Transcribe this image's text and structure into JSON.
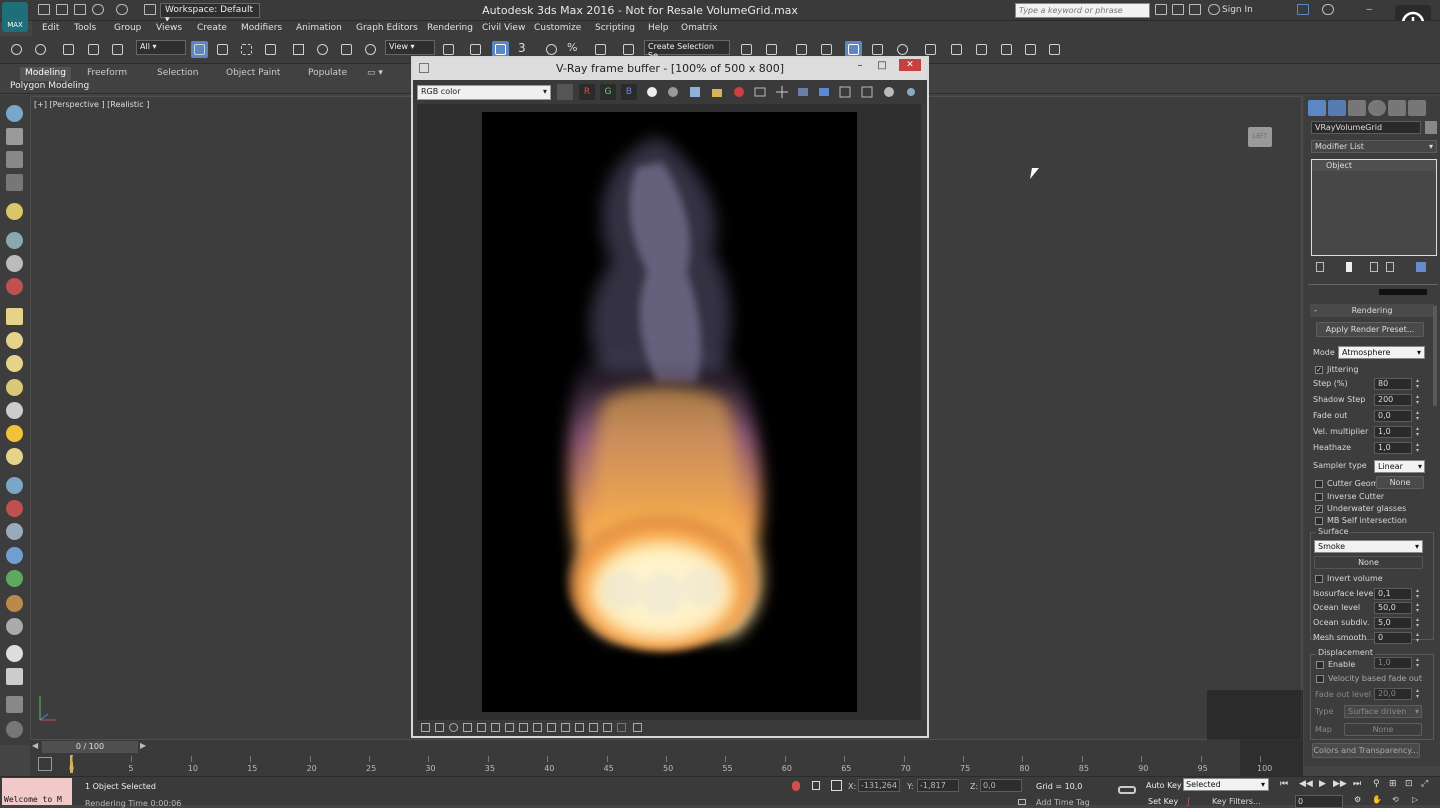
{
  "titlebar": {
    "app_icon_label": "MAX",
    "workspace": "Workspace: Default",
    "title": "Autodesk 3ds Max 2016 - Not for Resale    VolumeGrid.max",
    "search_placeholder": "Type a keyword or phrase",
    "sign_in": "Sign In"
  },
  "menu": [
    "Edit",
    "Tools",
    "Group",
    "Views",
    "Create",
    "Modifiers",
    "Animation",
    "Graph Editors",
    "Rendering",
    "Civil View",
    "Customize",
    "Scripting",
    "Help",
    "Omatrix"
  ],
  "toolbar": {
    "selection_filter": "All",
    "ref_coord": "View",
    "named_selection": "Create Selection Se",
    "snap_3": "3",
    "snap_pct": "%"
  },
  "ribbon": {
    "tabs": [
      "Modeling",
      "Freeform",
      "Selection",
      "Object Paint",
      "Populate"
    ],
    "active_tab": "Modeling",
    "subtab": "Polygon Modeling"
  },
  "viewport": {
    "label": "[+] [Perspective ] [Realistic ]",
    "viewcube": "LEFT"
  },
  "vfb": {
    "title": "V-Ray frame buffer - [100% of 500 x 800]",
    "channel": "RGB color",
    "channel_buttons": [
      "R",
      "G",
      "B"
    ]
  },
  "command_panel": {
    "object_name": "VRayVolumeGrid",
    "modifier_list": "Modifier List",
    "stack_item": "Object",
    "rollout_rendering": "Rendering",
    "apply_preset": "Apply Render Preset...",
    "mode_label": "Mode",
    "mode_value": "Atmosphere",
    "jittering_label": "Jittering",
    "jittering": true,
    "params": [
      {
        "label": "Step (%)",
        "value": "80"
      },
      {
        "label": "Shadow Step",
        "value": "200"
      },
      {
        "label": "Fade out",
        "value": "0,0"
      },
      {
        "label": "Vel. multiplier",
        "value": "1,0"
      },
      {
        "label": "Heathaze",
        "value": "1,0"
      }
    ],
    "sampler_label": "Sampler type",
    "sampler_value": "Linear",
    "cutter_geom_label": "Cutter Geom",
    "cutter_geom_value": "None",
    "inverse_cutter": "Inverse Cutter",
    "underwater": "Underwater glasses",
    "mb_self": "MB Self intersection",
    "surface_group": "Surface",
    "surface_value": "Smoke",
    "surface_none": "None",
    "invert_volume": "Invert volume",
    "surface_params": [
      {
        "label": "Isosurface level",
        "value": "0,1"
      },
      {
        "label": "Ocean level",
        "value": "50,0"
      },
      {
        "label": "Ocean subdiv.",
        "value": "5,0"
      },
      {
        "label": "Mesh smooth",
        "value": "0"
      }
    ],
    "displacement_group": "Displacement",
    "enable_label": "Enable",
    "enable_value": "1,0",
    "velocity_fade": "Velocity based fade out",
    "fade_out_level_label": "Fade out level",
    "fade_out_level_value": "20,0",
    "type_label": "Type",
    "type_value": "Surface driven",
    "map_label": "Map",
    "map_value": "None",
    "colors_btn": "Colors and Transparency..."
  },
  "timeline": {
    "slider": "0 / 100",
    "ticks": [
      "0",
      "5",
      "10",
      "15",
      "20",
      "25",
      "30",
      "35",
      "40",
      "45",
      "50",
      "55",
      "60",
      "65",
      "70",
      "75",
      "80",
      "85",
      "90",
      "95",
      "100"
    ]
  },
  "status": {
    "maxscript": "Welcome to M",
    "selection": "1 Object Selected",
    "render_time": "Rendering Time  0:00:06",
    "x_label": "X:",
    "x_value": "-131,264",
    "y_label": "Y:",
    "y_value": "-1,817",
    "z_label": "Z:",
    "z_value": "0,0",
    "grid": "Grid = 10,0",
    "add_time_tag": "Add Time Tag",
    "auto_key": "Auto Key",
    "set_key": "Set Key",
    "key_mode": "Selected",
    "key_filters": "Key Filters...",
    "frame": "0"
  },
  "colors": {
    "accent": "#5b87c4",
    "fire_core": "#fff1b5",
    "fire_mid": "#f4a24a",
    "smoke": "#8a84a8"
  }
}
